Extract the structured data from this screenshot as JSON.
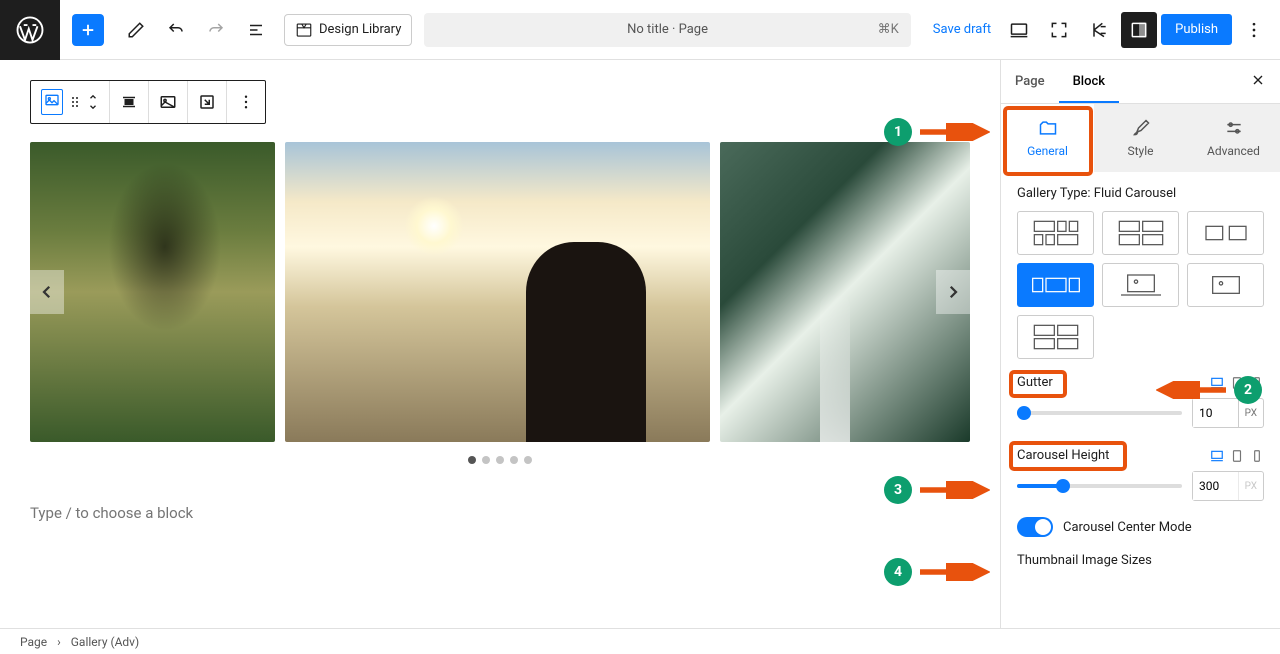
{
  "toolbar": {
    "design_library": "Design Library",
    "doc_title": "No title · Page",
    "kbd": "⌘K",
    "save_draft": "Save draft",
    "publish": "Publish"
  },
  "canvas": {
    "placeholder": "Type / to choose a block",
    "dots_count": 5,
    "active_dot": 0
  },
  "sidebar": {
    "tabs": {
      "page": "Page",
      "block": "Block"
    },
    "subtabs": {
      "general": "General",
      "style": "Style",
      "advanced": "Advanced"
    },
    "gallery_type_label": "Gallery Type: Fluid Carousel",
    "gutter": {
      "label": "Gutter",
      "value": "10",
      "unit": "PX",
      "slider_pct": 4
    },
    "height": {
      "label": "Carousel Height",
      "value": "300",
      "unit": "PX",
      "slider_pct": 28
    },
    "center_mode": {
      "label": "Carousel Center Mode",
      "on": true
    },
    "thumbnail_label": "Thumbnail Image Sizes"
  },
  "breadcrumb": {
    "root": "Page",
    "current": "Gallery (Adv)"
  },
  "callouts": {
    "1": "1",
    "2": "2",
    "3": "3",
    "4": "4"
  },
  "chart_data": null
}
